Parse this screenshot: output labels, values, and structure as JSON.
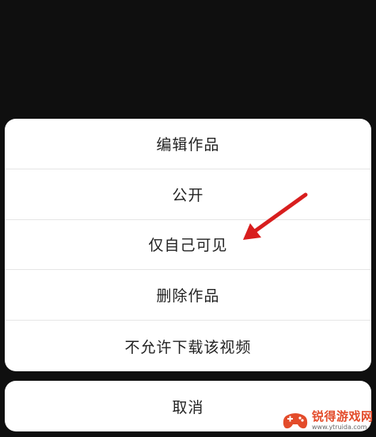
{
  "menu": {
    "items": [
      {
        "label": "编辑作品"
      },
      {
        "label": "公开"
      },
      {
        "label": "仅自己可见"
      },
      {
        "label": "删除作品"
      },
      {
        "label": "不允许下载该视频"
      }
    ],
    "cancel_label": "取消"
  },
  "annotation": {
    "arrow_color": "#d81e1e",
    "target": "仅自己可见"
  },
  "watermark": {
    "title": "锐得游戏网",
    "url": "www.ytruida.com",
    "accent_color": "#e34b2a"
  }
}
